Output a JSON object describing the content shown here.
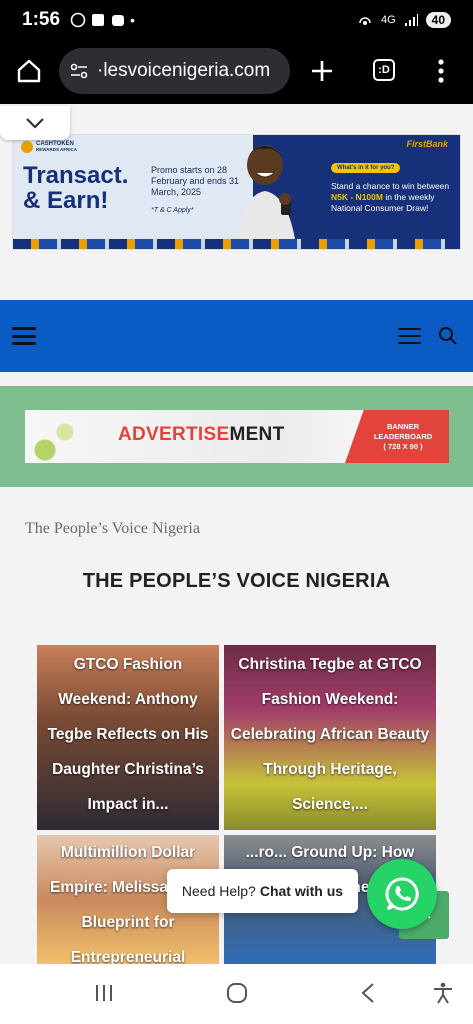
{
  "status_bar": {
    "time": "1:56",
    "network": "4G",
    "battery": "40",
    "dot": "•"
  },
  "browser": {
    "url": "·lesvoicenigeria.com",
    "tab_count": ":D"
  },
  "top_ad": {
    "brand_small": "CASHTOKEN",
    "brand_sub": "REWARDS AFRICA",
    "headline_line1": "Transact.",
    "headline_line2": "& Earn!",
    "promo_text": "Promo starts on 28 February and ends 31 March, 2025",
    "tc": "*T & C Apply*",
    "bank": "FirstBank",
    "badge": "What's in it for you?",
    "desc_before": "Stand a chance to win between ",
    "desc_highlight": "N5K - N100M",
    "desc_after": " in the weekly National Consumer Draw!"
  },
  "leaderboard_ad": {
    "text_red": "ADVERTISE",
    "text_dark": "MENT",
    "tag_line1": "BANNER",
    "tag_line2": "LEADERBOARD",
    "tag_line3": "( 728 X 90 )"
  },
  "breadcrumb": "The People’s Voice Nigeria",
  "page_title": "THE PEOPLE’S VOICE NIGERIA",
  "articles": [
    {
      "title": "GTCO Fashion Weekend: Anthony Tegbe Reflects on His Daughter Christina’s Impact in..."
    },
    {
      "title": "Christina Tegbe at GTCO Fashion Weekend: Celebrating African Beauty Through Heritage, Science,..."
    },
    {
      "title": "Multimillion Dollar Empire: Melissa Bu... Blueprint for Entrepreneurial Success"
    },
    {
      "title": "...ro... Ground Up: How Nige... Entrepreneurs Are"
    }
  ],
  "chat": {
    "prompt": "Need Help?",
    "action": "Chat with us"
  },
  "colors": {
    "nav": "#0b5bc4",
    "green": "#7fbf8f",
    "whatsapp": "#25d366"
  }
}
